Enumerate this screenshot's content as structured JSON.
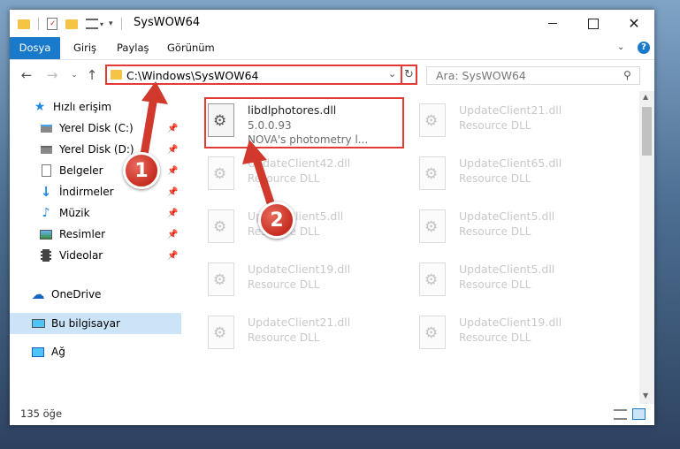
{
  "window": {
    "title": "SysWOW64"
  },
  "ribbon": {
    "tabs": [
      "Dosya",
      "Giriş",
      "Paylaş",
      "Görünüm"
    ]
  },
  "address": {
    "path": "C:\\Windows\\SysWOW64"
  },
  "search": {
    "placeholder": "Ara: SysWOW64"
  },
  "sidebar": {
    "items": [
      {
        "label": "Hızlı erişim",
        "icon": "star-icon",
        "pinned": false
      },
      {
        "label": "Yerel Disk (C:)",
        "icon": "drive-icon",
        "pinned": true
      },
      {
        "label": "Yerel Disk (D:)",
        "icon": "drive-icon",
        "pinned": true
      },
      {
        "label": "Belgeler",
        "icon": "documents-icon",
        "pinned": true
      },
      {
        "label": "İndirmeler",
        "icon": "download-icon",
        "pinned": true
      },
      {
        "label": "Müzik",
        "icon": "music-icon",
        "pinned": true
      },
      {
        "label": "Resimler",
        "icon": "pictures-icon",
        "pinned": true
      },
      {
        "label": "Videolar",
        "icon": "videos-icon",
        "pinned": true
      },
      {
        "label": "OneDrive",
        "icon": "cloud-icon",
        "pinned": false
      },
      {
        "label": "Bu bilgisayar",
        "icon": "computer-icon",
        "pinned": false,
        "selected": true
      },
      {
        "label": "Ağ",
        "icon": "network-icon",
        "pinned": false
      }
    ]
  },
  "files": [
    {
      "name": "libdlphotores.dll",
      "version": "5.0.0.93",
      "description": "NOVA's photometry l...",
      "highlighted": true
    },
    {
      "name": "UpdateClient21.dll",
      "version": "Resource DLL"
    },
    {
      "name": "UpdateClient42.dll",
      "version": "Resource DLL"
    },
    {
      "name": "UpdateClient65.dll",
      "version": "Resource DLL"
    },
    {
      "name": "UpdateClient5.dll",
      "version": "Resource DLL"
    },
    {
      "name": "UpdateClient5.dll",
      "version": "Resource DLL"
    },
    {
      "name": "UpdateClient19.dll",
      "version": "Resource DLL"
    },
    {
      "name": "UpdateClient5.dll",
      "version": "Resource DLL"
    },
    {
      "name": "UpdateClient21.dll",
      "version": "Resource DLL"
    },
    {
      "name": "UpdateClient19.dll",
      "version": "Resource DLL"
    }
  ],
  "status": {
    "count": "135 öğe"
  },
  "annotations": {
    "step1": "1",
    "step2": "2"
  },
  "colors": {
    "accent": "#1979ca",
    "highlight": "#e53935",
    "selected": "#cce4f7"
  }
}
